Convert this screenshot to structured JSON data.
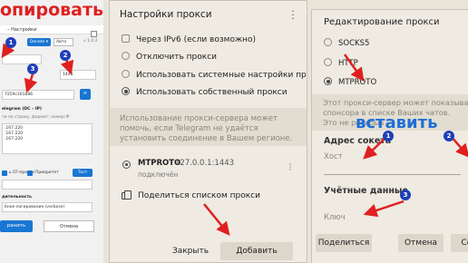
{
  "left_panel": {
    "heading": "опировать",
    "window_title": "– Настройки",
    "brand_button": "Donate ▾",
    "auto_select": "Авто",
    "version": "v 1.0.2",
    "port_value": "1443",
    "secret_value": "7259c161b86",
    "list_label": "elegram (DC – IP)",
    "list_hint": "ти по строку, формат: номер:IP",
    "list_items": [
      ".167.220",
      ".167.220",
      ".167.220"
    ],
    "proxy_label": "ь CF-прокси",
    "priority_label": "Приоритет",
    "test_button": "Тест",
    "perf_label": "дительность",
    "log_label": "бное логирование (verbose)",
    "save_button": "ранить",
    "cancel_button": "Отмена"
  },
  "proxy_settings": {
    "title": "Настройки прокси",
    "options": [
      {
        "label": "Через IPv6 (если возможно)",
        "type": "checkbox",
        "checked": false
      },
      {
        "label": "Отключить прокси",
        "type": "radio",
        "checked": false
      },
      {
        "label": "Использовать системные настройки прокси",
        "type": "radio",
        "checked": false
      },
      {
        "label": "Использовать собственный прокси",
        "type": "radio",
        "checked": true
      }
    ],
    "info_text": "Использование прокси-сервера может помочь, если Telegram не удаётся установить соединение в Вашем регионе.",
    "proxy_type": "MTPROTO",
    "proxy_address": "127.0.0.1:1443",
    "proxy_status": "подключён",
    "share_list": "Поделиться списком прокси",
    "close_button": "Закрыть",
    "add_button": "Добавить прокси"
  },
  "edit_proxy": {
    "title": "Редактирование прокси",
    "options": [
      {
        "label": "SOCKS5",
        "checked": false
      },
      {
        "label": "HTTP",
        "checked": false
      },
      {
        "label": "MTPROTO",
        "checked": true
      }
    ],
    "desc_lines": [
      "Этот прокси-сервер может показывать ка",
      "спонсора в списке Ваших чатов.",
      "Это не раскрыв"
    ],
    "socket_header": "Адрес сокета",
    "host_hint": "Хост",
    "cred_header": "Учётные данные",
    "key_hint": "Ключ",
    "share_button": "Поделиться",
    "cancel_button": "Отмена",
    "save_button": "Сох"
  },
  "annotations": {
    "paste_label": "вставить",
    "markers": [
      "1",
      "2",
      "3",
      "1",
      "2",
      "3"
    ],
    "color_copy": "#e02020",
    "color_paste": "#1e6fd9",
    "color_arrow": "#e02020",
    "color_marker": "#1f3fb8"
  }
}
